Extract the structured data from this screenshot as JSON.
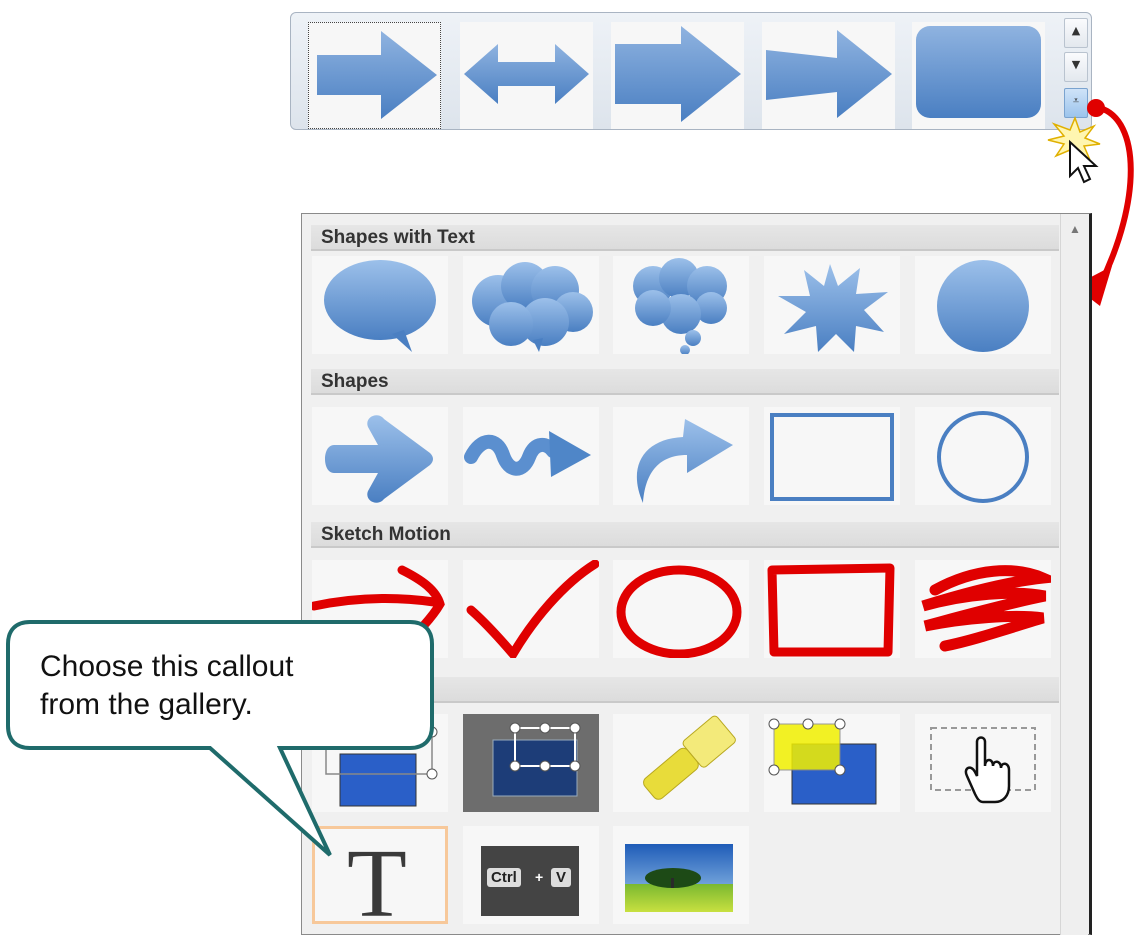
{
  "top_gallery": {
    "items": [
      {
        "name": "right-arrow"
      },
      {
        "name": "double-arrow"
      },
      {
        "name": "chevron-arrow"
      },
      {
        "name": "tapered-arrow"
      },
      {
        "name": "rounded-rectangle"
      }
    ],
    "scroll_up": "▲",
    "scroll_down": "▼",
    "more": "⩡"
  },
  "panel": {
    "sections": [
      {
        "title": "Shapes with Text"
      },
      {
        "title": "Shapes"
      },
      {
        "title": "Sketch Motion"
      },
      {
        "title": ""
      }
    ],
    "scroll_up": "▲"
  },
  "callout": {
    "line1": "Choose this callout",
    "line2": "from the gallery."
  },
  "keys": {
    "ctrl": "Ctrl",
    "plus": "+",
    "v": "V"
  },
  "text_tool_letter": "T",
  "colors": {
    "shape_blue": "#5b8fcf",
    "sketch_red": "#e00000",
    "callout_border": "#1f6b6b",
    "selection_orange": "#f7c89a"
  }
}
